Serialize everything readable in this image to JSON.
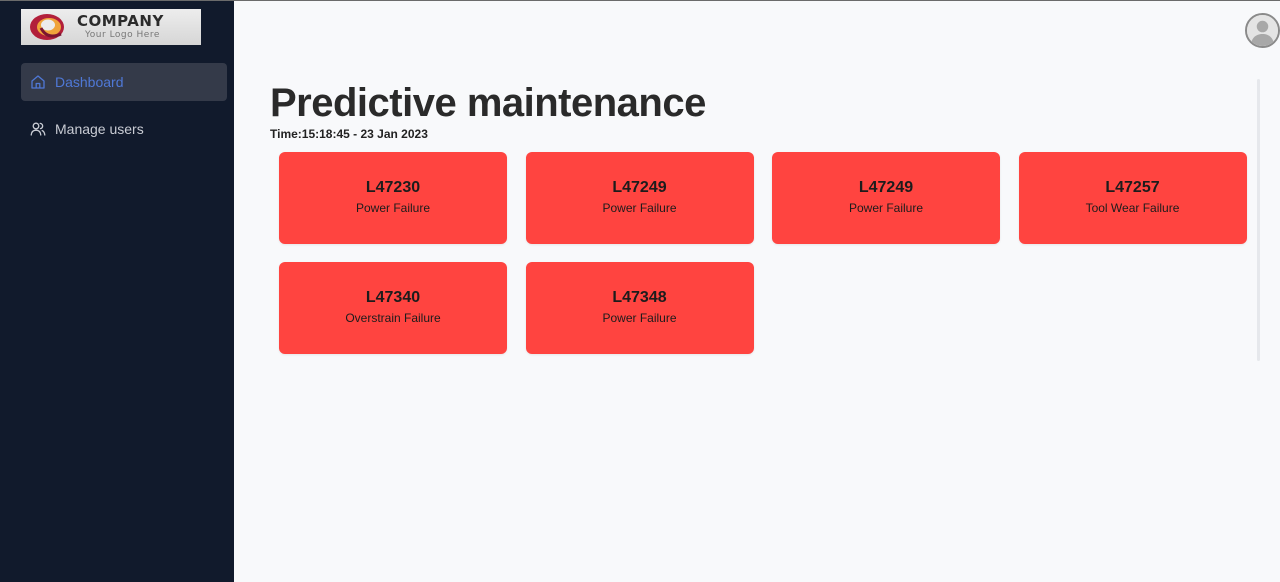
{
  "logo": {
    "title": "COMPANY",
    "subtitle": "Your Logo Here"
  },
  "sidebar": {
    "items": [
      {
        "label": "Dashboard",
        "icon": "home-icon",
        "active": true
      },
      {
        "label": "Manage users",
        "icon": "users-icon",
        "active": false
      }
    ]
  },
  "main": {
    "title": "Predictive maintenance",
    "time": "Time:15:18:45 - 23 Jan 2023",
    "cards": [
      {
        "id": "L47230",
        "status": "Power Failure"
      },
      {
        "id": "L47249",
        "status": "Power Failure"
      },
      {
        "id": "L47249",
        "status": "Power Failure"
      },
      {
        "id": "L47257",
        "status": "Tool Wear Failure"
      },
      {
        "id": "L47340",
        "status": "Overstrain Failure"
      },
      {
        "id": "L47348",
        "status": "Power Failure"
      }
    ]
  },
  "colors": {
    "sidebar_bg": "#111a2c",
    "active_nav_bg": "#343a49",
    "active_nav_text": "#4f78d6",
    "card_alert": "#ff4440",
    "page_bg": "#f8f9fb"
  }
}
